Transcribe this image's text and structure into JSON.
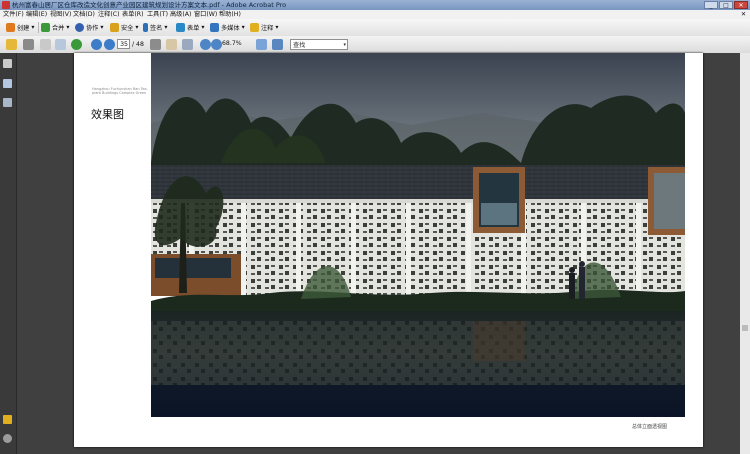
{
  "window": {
    "title": "杭州富春山居厂区仓库改造文化创意产业园区建筑规划设计方案文本.pdf - Adobe Acrobat Pro",
    "buttons": [
      "_",
      "□",
      "✕"
    ]
  },
  "menu": [
    "文件(F)",
    "编辑(E)",
    "视图(V)",
    "文档(D)",
    "注释(C)",
    "表单(R)",
    "工具(T)",
    "高级(A)",
    "窗口(W)",
    "帮助(H)"
  ],
  "menu_close": "✕",
  "toolbar": {
    "create": "创建",
    "combine": "合并",
    "collaborate": "协作",
    "secure": "安全",
    "sign": "签名",
    "forms": "表单",
    "multimedia": "多媒体",
    "comment": "注释",
    "dropdown_arrow": "▾"
  },
  "nav": {
    "current_page": "35",
    "total_pages": "/ 48",
    "zoom": "68.7%",
    "search_placeholder": "查找",
    "search_dd": "▾"
  },
  "icons": {
    "create": "create-pdf-icon",
    "combine": "combine-icon",
    "collaborate": "collaborate-icon",
    "secure": "lock-icon",
    "sign": "pen-icon",
    "forms": "form-icon",
    "multimedia": "multimedia-icon",
    "comment": "comment-icon"
  },
  "page": {
    "subtitle": "Hangzhou Fuchunshan Ran Tea-plant Buildings Complex Green",
    "heading": "效果图",
    "caption": "总体立面透视图"
  },
  "colors": {
    "create": "#e07a1f",
    "combine": "#3a9a3a",
    "collaborate": "#3560b0",
    "secure": "#d8a21b",
    "sign": "#2f6fb5",
    "forms": "#2a8ac8",
    "multimedia": "#3375c0",
    "comment": "#e0b020"
  }
}
